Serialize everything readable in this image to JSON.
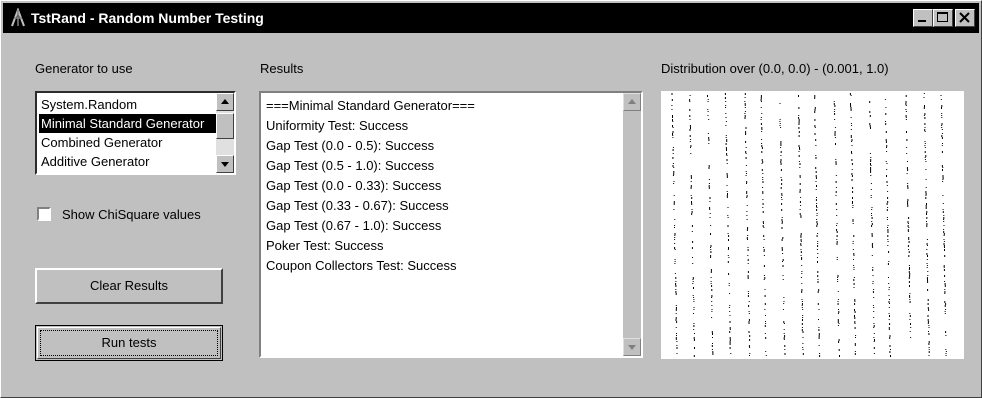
{
  "window": {
    "title": "TstRand - Random Number Testing",
    "icon": "app-icon",
    "controls": [
      "minimize-icon",
      "maximize-icon",
      "close-icon"
    ]
  },
  "generator": {
    "label": "Generator to use",
    "items": [
      {
        "label": "System.Random",
        "selected": false
      },
      {
        "label": "Minimal Standard Generator",
        "selected": true
      },
      {
        "label": "Combined Generator",
        "selected": false
      },
      {
        "label": "Additive Generator",
        "selected": false
      }
    ]
  },
  "options": {
    "show_chisquare_label": "Show ChiSquare values",
    "show_chisquare_checked": false
  },
  "buttons": {
    "clear": "Clear Results",
    "run": "Run tests"
  },
  "results": {
    "label": "Results",
    "lines": [
      "===Minimal Standard Generator===",
      "Uniformity Test: Success",
      "Gap Test (0.0 - 0.5): Success",
      "Gap Test (0.5 - 1.0): Success",
      "Gap Test (0.0 - 0.33): Success",
      "Gap Test (0.33 - 0.67): Success",
      "Gap Test (0.67 - 1.0): Success",
      "Poker Test: Success",
      "Coupon Collectors Test: Success"
    ]
  },
  "distribution": {
    "label": "Distribution over (0.0, 0.0) - (0.001, 1.0)",
    "line_count": 16
  },
  "colors": {
    "face": "#c0c0c0",
    "titlebar": "#000000",
    "selection": "#000000"
  }
}
